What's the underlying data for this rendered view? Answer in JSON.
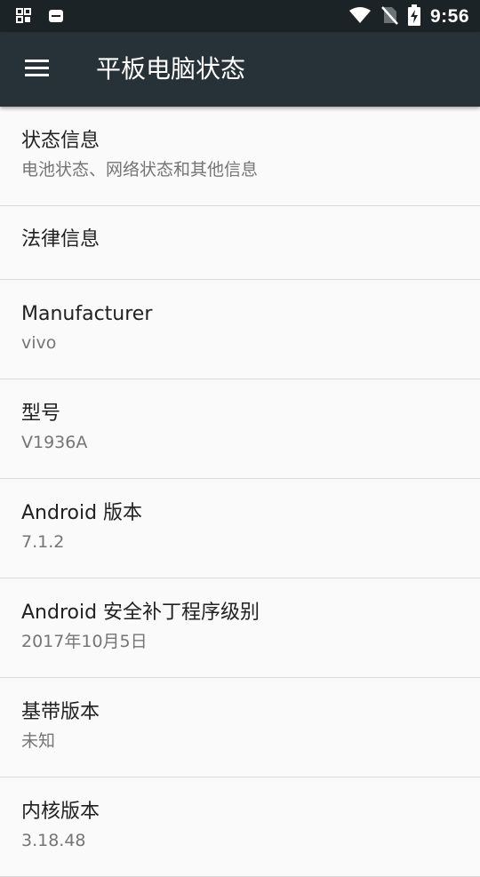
{
  "status_bar": {
    "time": "9:56",
    "left_icons": [
      "grid-app-icon",
      "notification-app-icon"
    ],
    "right_icons": [
      "wifi-icon",
      "no-sim-icon",
      "battery-charging-icon"
    ]
  },
  "app_bar": {
    "menu_icon": "menu-icon",
    "title": "平板电脑状态"
  },
  "items": [
    {
      "title": "状态信息",
      "subtitle": "电池状态、网络状态和其他信息"
    },
    {
      "title": "法律信息"
    },
    {
      "title": "Manufacturer",
      "subtitle": "vivo"
    },
    {
      "title": "型号",
      "subtitle": "V1936A"
    },
    {
      "title": "Android 版本",
      "subtitle": "7.1.2"
    },
    {
      "title": "Android 安全补丁程序级别",
      "subtitle": "2017年10月5日"
    },
    {
      "title": "基带版本",
      "subtitle": "未知"
    },
    {
      "title": "内核版本",
      "subtitle": "3.18.48"
    }
  ],
  "colors": {
    "status_bar": "#1b2326",
    "app_bar": "#263238",
    "background": "#fafafa",
    "title_text": "#212121",
    "subtitle_text": "#757575",
    "divider": "#d9d9d9"
  }
}
